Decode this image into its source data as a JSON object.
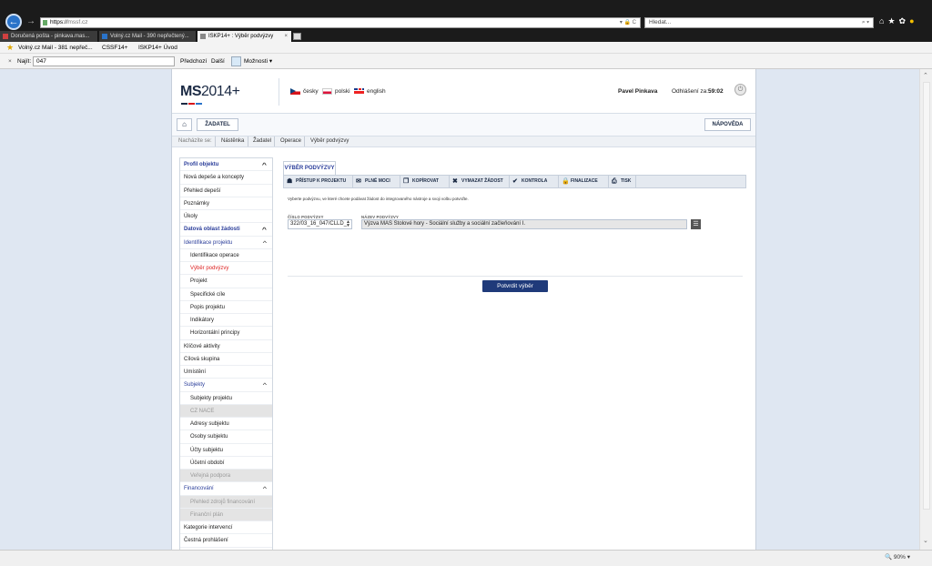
{
  "browser": {
    "address": "https://",
    "address_domain": "mssf.cz",
    "search_placeholder": "Hledat...",
    "tabs": [
      {
        "label": "Doručená pošta - pinkava.mas...",
        "icon_color": "#d04040"
      },
      {
        "label": "Volný.cz Mail - 390 nepřečtený...",
        "icon_color": "#2a73c9"
      },
      {
        "label": "ISKP14+ : Výběr podvýzvy",
        "icon_color": "#888888"
      }
    ],
    "favorites": [
      {
        "label": "Volný.cz Mail - 381 nepřeč..."
      },
      {
        "label": "CSSF14+"
      },
      {
        "label": "ISKP14+ Úvod"
      }
    ],
    "find": {
      "label": "Najít:",
      "value": "047",
      "prev": "Předchozí",
      "next": "Další",
      "options": "Možnosti"
    },
    "zoom": "90%"
  },
  "app": {
    "logo_ms": "MS",
    "logo_year": "2014+",
    "languages": [
      "česky",
      "polski",
      "english"
    ],
    "user_name": "Pavel Pinkava",
    "logout_label": "Odhlášení za:",
    "logout_time": "59:02",
    "home_label": "⌂",
    "role_label": "ŽADATEL",
    "help_label": "NÁPOVĚDA"
  },
  "breadcrumb": {
    "label": "Nacházíte se:",
    "items": [
      "Nástěnka",
      "Žadatel",
      "Operace",
      "Výběr podvýzvy"
    ]
  },
  "sidebar": {
    "items": [
      {
        "label": "Profil objektu",
        "kind": "section bold",
        "chev": true
      },
      {
        "label": "Nová depeše a koncepty",
        "kind": ""
      },
      {
        "label": "Přehled depeší",
        "kind": ""
      },
      {
        "label": "Poznámky",
        "kind": ""
      },
      {
        "label": "Úkoly",
        "kind": ""
      },
      {
        "label": "Datová oblast žádosti",
        "kind": "section bold",
        "chev": true
      },
      {
        "label": "Identifikace projektu",
        "kind": "section",
        "chev": true
      },
      {
        "label": "Identifikace operace",
        "kind": "sub"
      },
      {
        "label": "Výběr podvýzvy",
        "kind": "sub active"
      },
      {
        "label": "Projekt",
        "kind": "sub"
      },
      {
        "label": "Specifické cíle",
        "kind": "sub"
      },
      {
        "label": "Popis projektu",
        "kind": "sub"
      },
      {
        "label": "Indikátory",
        "kind": "sub"
      },
      {
        "label": "Horizontální principy",
        "kind": "sub"
      },
      {
        "label": "Klíčové aktivity",
        "kind": ""
      },
      {
        "label": "Cílová skupina",
        "kind": ""
      },
      {
        "label": "Umístění",
        "kind": ""
      },
      {
        "label": "Subjekty",
        "kind": "section",
        "chev": true
      },
      {
        "label": "Subjekty projektu",
        "kind": "sub"
      },
      {
        "label": "CZ NACE",
        "kind": "sub disabled"
      },
      {
        "label": "Adresy subjektu",
        "kind": "sub"
      },
      {
        "label": "Osoby subjektu",
        "kind": "sub"
      },
      {
        "label": "Účty subjektu",
        "kind": "sub"
      },
      {
        "label": "Účetní období",
        "kind": "sub"
      },
      {
        "label": "Veřejná podpora",
        "kind": "sub disabled"
      },
      {
        "label": "Financování",
        "kind": "section",
        "chev": true
      },
      {
        "label": "Přehled zdrojů financování",
        "kind": "sub disabled"
      },
      {
        "label": "Finanční plán",
        "kind": "sub disabled"
      },
      {
        "label": "Kategorie intervencí",
        "kind": ""
      },
      {
        "label": "Čestná prohlášení",
        "kind": ""
      }
    ]
  },
  "main": {
    "tab_label": "VÝBĚR PODVÝZVY",
    "actions": [
      {
        "label": "PŘÍSTUP K PROJEKTU",
        "icon": "☗"
      },
      {
        "label": "PLNÉ MOCI",
        "icon": "✉"
      },
      {
        "label": "KOPÍROVAT",
        "icon": "❐"
      },
      {
        "label": "VYMAZAT ŽÁDOST",
        "icon": "✖"
      },
      {
        "label": "KONTROLA",
        "icon": "✔"
      },
      {
        "label": "FINALIZACE",
        "icon": "🔒"
      },
      {
        "label": "TISK",
        "icon": "⎙"
      }
    ],
    "instruction": "Vyberte podvýzvu, ve které chcete podávat žádost do integrovaného nástroje a svoji volbu potvrďte.",
    "call_number_label": "ČÍSLO PODVÝZVY",
    "call_number_value": "322/03_16_047/CLLD_",
    "call_name_label": "NÁZEV PODVÝZVY",
    "call_name_value": "Výzva MAS Stolové hory - Sociální služby a sociální začleňování I.",
    "confirm_label": "Potvrdit výběr"
  }
}
